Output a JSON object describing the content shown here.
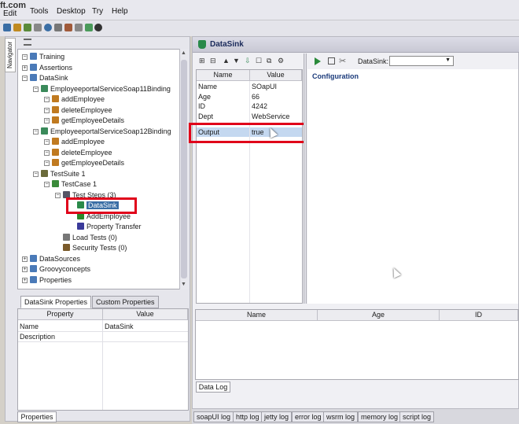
{
  "menubar": {
    "brand": "ft.com",
    "items": [
      "Edit",
      "Tools",
      "Desktop",
      "Try",
      "Help"
    ]
  },
  "navigator_tab": "Navigator",
  "tree": [
    {
      "label": "Training",
      "icon": "project-icon",
      "level": 0,
      "color": "#4a7ab8"
    },
    {
      "label": "Assertions",
      "icon": "project-icon",
      "level": 0,
      "color": "#4a7ab8"
    },
    {
      "label": "DataSink",
      "icon": "project-icon",
      "level": 0,
      "color": "#4a7ab8"
    },
    {
      "label": "EmployeeportalServiceSoap11Binding",
      "icon": "interface-icon",
      "level": 1,
      "color": "#3a8a5a"
    },
    {
      "label": "addEmployee",
      "icon": "operation-icon",
      "level": 2,
      "color": "#c07a20"
    },
    {
      "label": "deleteEmployee",
      "icon": "operation-icon",
      "level": 2,
      "color": "#c07a20"
    },
    {
      "label": "getEmployeeDetails",
      "icon": "operation-icon",
      "level": 2,
      "color": "#c07a20"
    },
    {
      "label": "EmployeeportalServiceSoap12Binding",
      "icon": "interface-icon",
      "level": 1,
      "color": "#3a8a5a"
    },
    {
      "label": "addEmployee",
      "icon": "operation-icon",
      "level": 2,
      "color": "#c07a20"
    },
    {
      "label": "deleteEmployee",
      "icon": "operation-icon",
      "level": 2,
      "color": "#c07a20"
    },
    {
      "label": "getEmployeeDetails",
      "icon": "operation-icon",
      "level": 2,
      "color": "#c07a20"
    },
    {
      "label": "TestSuite 1",
      "icon": "testsuite-icon",
      "level": 1,
      "color": "#6a6a3a"
    },
    {
      "label": "TestCase 1",
      "icon": "testcase-icon",
      "level": 2,
      "color": "#3a8a3a"
    },
    {
      "label": "Test Steps (3)",
      "icon": "teststeps-icon",
      "level": 3,
      "color": "#555566"
    },
    {
      "label": "DataSink",
      "icon": "datasink-icon",
      "level": 4,
      "color": "#2a8a4a",
      "selected": true
    },
    {
      "label": "AddEmployee",
      "icon": "soap-request-icon",
      "level": 4,
      "color": "#2a8a2a"
    },
    {
      "label": "Property Transfer",
      "icon": "property-transfer-icon",
      "level": 4,
      "color": "#3a3a9a"
    },
    {
      "label": "Load Tests (0)",
      "icon": "loadtest-icon",
      "level": 3,
      "color": "#777"
    },
    {
      "label": "Security Tests (0)",
      "icon": "securitytest-icon",
      "level": 3,
      "color": "#7a5a2a"
    },
    {
      "label": "DataSources",
      "icon": "project-icon",
      "level": 0,
      "color": "#4a7ab8"
    },
    {
      "label": "Groovyconcepts",
      "icon": "project-icon",
      "level": 0,
      "color": "#4a7ab8"
    },
    {
      "label": "Properties",
      "icon": "project-icon",
      "level": 0,
      "color": "#4a7ab8"
    }
  ],
  "props_panel": {
    "tabs": [
      "DataSink Properties",
      "Custom Properties"
    ],
    "headers": [
      "Property",
      "Value"
    ],
    "rows": [
      [
        "Name",
        "DataSink"
      ],
      [
        "Description",
        ""
      ]
    ],
    "bottom_tab": "Properties"
  },
  "datasink_window": {
    "title": "DataSink",
    "grid_headers": [
      "Name",
      "Value"
    ],
    "grid_rows": [
      [
        "Name",
        "SOapUI"
      ],
      [
        "Age",
        "66"
      ],
      [
        "ID",
        "4242"
      ],
      [
        "Dept",
        "WebService"
      ],
      [
        "Output",
        "true"
      ]
    ],
    "datasink_label": "DataSink:",
    "config_label": "Configuration",
    "log_headers": [
      "Name",
      "Age",
      "ID"
    ],
    "log_tab": "Data Log"
  },
  "status_tabs": [
    "soapUI log",
    "http log",
    "jetty log",
    "error log",
    "wsrm log",
    "memory log",
    "script log"
  ],
  "colors": {
    "highlight": "#e0001a",
    "selection": "#3a6ea5"
  }
}
